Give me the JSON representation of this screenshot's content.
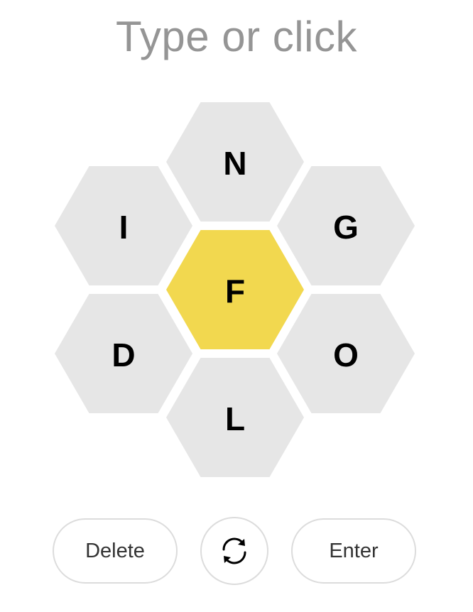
{
  "prompt": "Type or click",
  "hive": {
    "center": {
      "letter": "F",
      "color": "#f2d84f"
    },
    "outer": [
      {
        "position": "top",
        "letter": "N"
      },
      {
        "position": "upper-left",
        "letter": "I"
      },
      {
        "position": "upper-right",
        "letter": "G"
      },
      {
        "position": "lower-left",
        "letter": "D"
      },
      {
        "position": "lower-right",
        "letter": "O"
      },
      {
        "position": "bottom",
        "letter": "L"
      }
    ],
    "outer_color": "#e6e6e6"
  },
  "controls": {
    "delete_label": "Delete",
    "shuffle_icon": "shuffle-icon",
    "enter_label": "Enter"
  }
}
